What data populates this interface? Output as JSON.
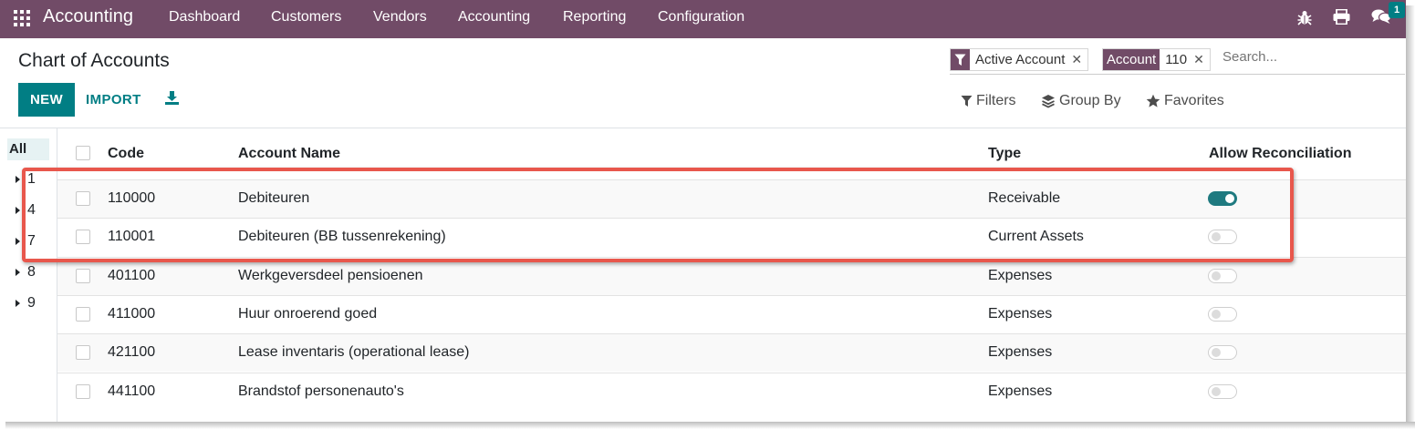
{
  "navbar": {
    "app_title": "Accounting",
    "menu": [
      "Dashboard",
      "Customers",
      "Vendors",
      "Accounting",
      "Reporting",
      "Configuration"
    ],
    "icons": [
      "bug-icon",
      "print-icon",
      "chat-icon"
    ],
    "chat_badge": "1",
    "bg_color": "#714b67"
  },
  "control_panel": {
    "title": "Chart of Accounts",
    "new_label": "NEW",
    "import_label": "IMPORT",
    "filters_label": "Filters",
    "groupby_label": "Group By",
    "favorites_label": "Favorites",
    "search_placeholder": "Search...",
    "facets": [
      {
        "head_icon": "filter-icon",
        "value": "Active Account"
      },
      {
        "head": "Account",
        "value": "110"
      }
    ],
    "accent_color": "#017e84"
  },
  "side_panel": {
    "all_label": "All",
    "groups": [
      "1",
      "4",
      "7",
      "8",
      "9"
    ]
  },
  "table": {
    "columns": [
      "Code",
      "Account Name",
      "Type",
      "Allow Reconciliation"
    ],
    "rows": [
      {
        "code": "110000",
        "name": "Debiteuren",
        "type": "Receivable",
        "reconcile": true
      },
      {
        "code": "110001",
        "name": "Debiteuren (BB tussenrekening)",
        "type": "Current Assets",
        "reconcile": false
      },
      {
        "code": "401100",
        "name": "Werkgeversdeel pensioenen",
        "type": "Expenses",
        "reconcile": false
      },
      {
        "code": "411000",
        "name": "Huur onroerend goed",
        "type": "Expenses",
        "reconcile": false
      },
      {
        "code": "421100",
        "name": "Lease inventaris (operational lease)",
        "type": "Expenses",
        "reconcile": false
      },
      {
        "code": "441100",
        "name": "Brandstof personenauto's",
        "type": "Expenses",
        "reconcile": false
      }
    ]
  },
  "highlight_color": "#e8574c"
}
